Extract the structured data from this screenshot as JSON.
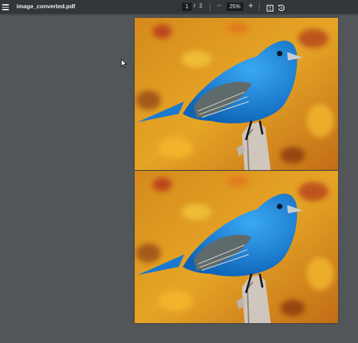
{
  "toolbar": {
    "menu_icon": "hamburger-menu-icon",
    "title": "image_converted.pdf",
    "current_page": "1",
    "page_separator": "/",
    "total_pages": "2",
    "zoom_out_icon": "minus-icon",
    "zoom_level": "25%",
    "zoom_in_icon": "plus-icon",
    "fit_icon": "fit-to-page-icon",
    "rotate_icon": "rotate-counterclockwise-icon"
  },
  "pages": [
    {
      "number": 1,
      "content": "bird-image"
    },
    {
      "number": 2,
      "content": "bird-image"
    }
  ],
  "colors": {
    "toolbar_bg": "#323639",
    "viewer_bg": "#525659",
    "bird_blue": "#1f8fe0",
    "background_orange": "#e0901f"
  }
}
